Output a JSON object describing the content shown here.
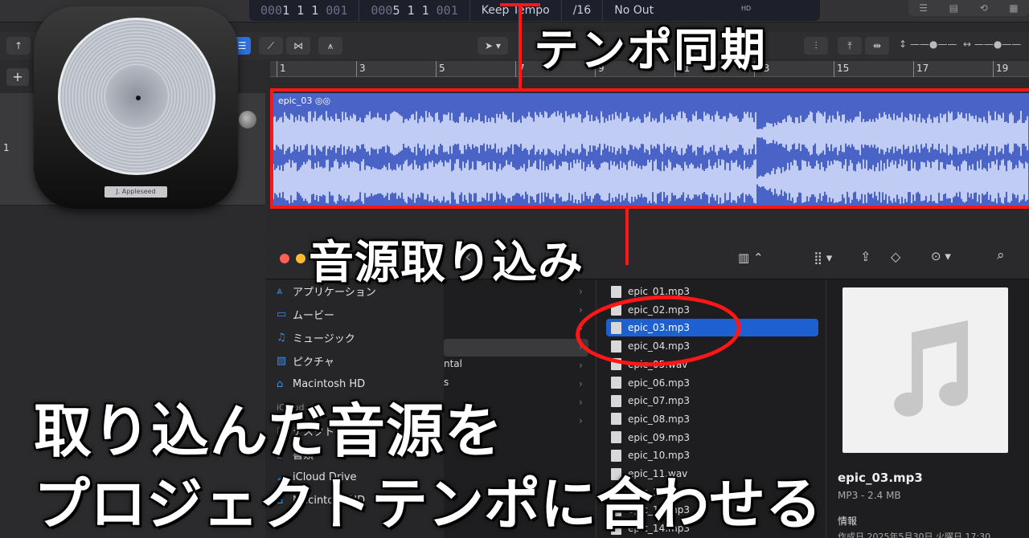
{
  "lcd": {
    "position": "1 1 1",
    "position_dim_lead": "000",
    "position_dim_tail": "001",
    "position2_dim": "000",
    "position2": "5 1 1",
    "position2_tail": "001",
    "tempo_mode": "Keep Tempo",
    "division": "/16",
    "output": "No Out",
    "hd": "HD"
  },
  "ruler": {
    "bars": [
      "1",
      "3",
      "5",
      "7",
      "9",
      "11",
      "13",
      "15",
      "17",
      "19"
    ]
  },
  "track": {
    "number": "1"
  },
  "region": {
    "name": "epic_03"
  },
  "app_icon": {
    "label": "J. Appleseed"
  },
  "annotations": {
    "tempo_sync": "テンポ同期",
    "import_audio": "音源取り込み"
  },
  "headline": {
    "line1": "取り込んだ音源を",
    "line2": "プロジェクトテンポに合わせる"
  },
  "finder": {
    "sidebar": [
      {
        "icon": "app-icon",
        "label": "アプリケーション"
      },
      {
        "icon": "movie-icon",
        "label": "ムービー"
      },
      {
        "icon": "music-icon",
        "label": "ミュージック"
      },
      {
        "icon": "picture-icon",
        "label": "ピクチャ"
      },
      {
        "icon": "disk-icon",
        "label": "Macintosh HD"
      },
      {
        "icon": "",
        "label": "iCloud"
      },
      {
        "icon": "desktop-icon",
        "label": "デスクトップ"
      },
      {
        "icon": "doc-icon",
        "label": "書類"
      },
      {
        "icon": "cloud-icon",
        "label": "iCloud Drive"
      },
      {
        "icon": "disk-icon",
        "label": "Macintosh HD"
      }
    ],
    "col1_partial": [
      "ntal",
      "s"
    ],
    "files": [
      "epic_01.mp3",
      "epic_02.mp3",
      "epic_03.mp3",
      "epic_04.mp3",
      "epic_05.wav",
      "epic_06.mp3",
      "epic_07.mp3",
      "epic_08.mp3",
      "epic_09.mp3",
      "epic_10.mp3",
      "epic_11.wav",
      "epic_12.mp3",
      "epic_13.mp3",
      "epic_14.mp3"
    ],
    "selected_file": "epic_03.mp3",
    "preview": {
      "name": "epic_03.mp3",
      "size": "MP3 - 2.4 MB",
      "info_label": "情報",
      "created": "作成日 2025年5月30日 火曜日 17:30"
    }
  },
  "colors": {
    "accent_red": "#ff1616",
    "region_blue": "#4a63c7",
    "selection_blue": "#1e5fd1"
  }
}
